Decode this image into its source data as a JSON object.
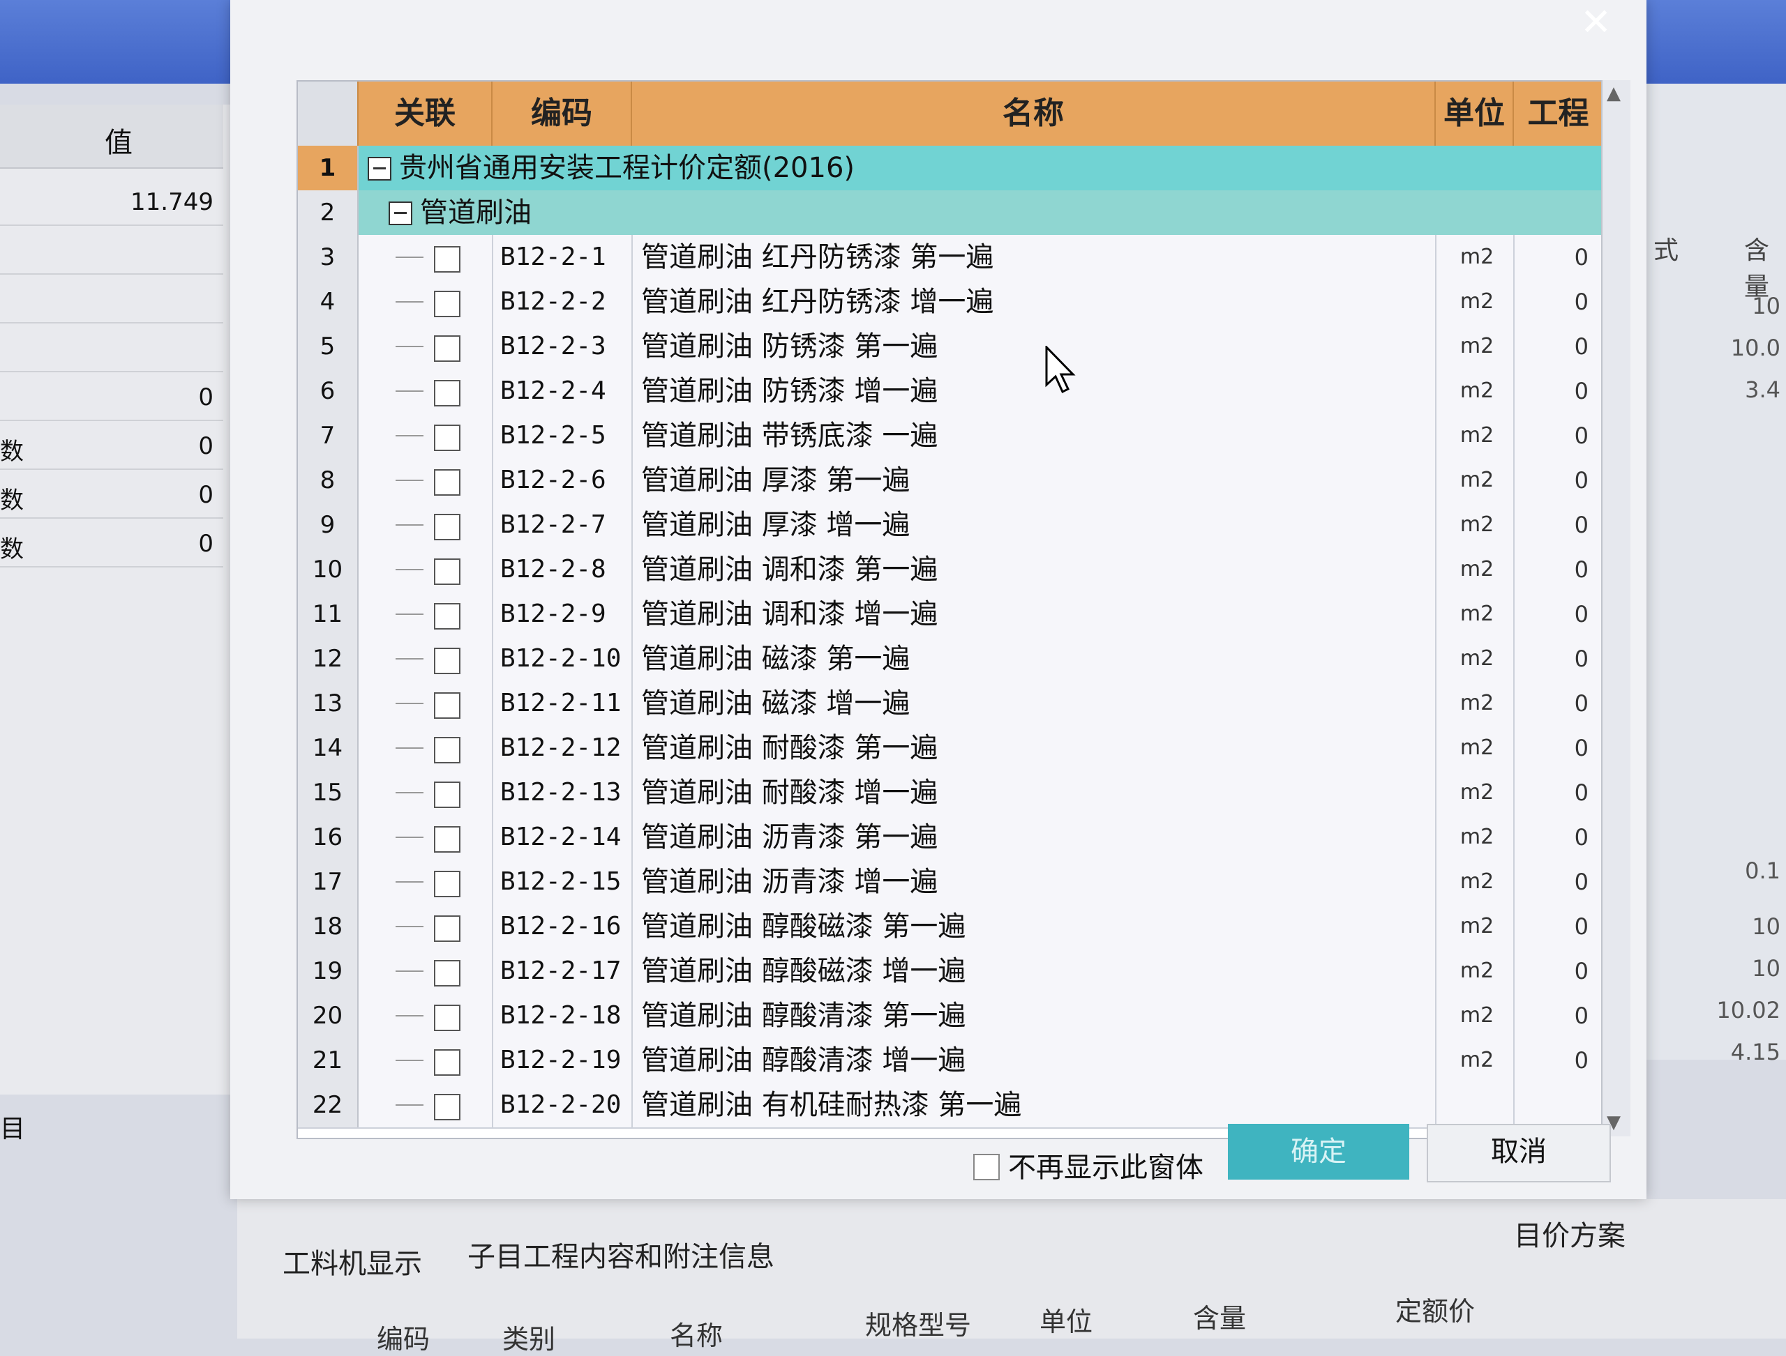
{
  "left_panel": {
    "header": "值",
    "rows": [
      {
        "label": "",
        "value": "11.749"
      },
      {
        "label": "",
        "value": ""
      },
      {
        "label": "",
        "value": ""
      },
      {
        "label": "",
        "value": ""
      },
      {
        "label": "",
        "value": "0"
      },
      {
        "label": "数",
        "value": "0"
      },
      {
        "label": "数",
        "value": "0"
      },
      {
        "label": "数",
        "value": "0"
      }
    ],
    "footer_label": "目"
  },
  "right_panel": {
    "header_left": "式",
    "header_right": "含量",
    "values": [
      "10",
      "10.0",
      "3.4",
      "0.1",
      "10",
      "10",
      "10.02",
      "4.15"
    ]
  },
  "dialog": {
    "close_label": "✕",
    "columns": {
      "relation": "关联",
      "code": "编码",
      "name": "名称",
      "unit": "单位",
      "quantity": "工程量"
    },
    "group1": {
      "num": "1",
      "title": "贵州省通用安装工程计价定额(2016)"
    },
    "group2": {
      "num": "2",
      "title": "管道刷油"
    },
    "items": [
      {
        "num": "3",
        "code": "B12-2-1",
        "name": "管道刷油 红丹防锈漆 第一遍",
        "unit": "m2",
        "qty": "0"
      },
      {
        "num": "4",
        "code": "B12-2-2",
        "name": "管道刷油 红丹防锈漆 增一遍",
        "unit": "m2",
        "qty": "0"
      },
      {
        "num": "5",
        "code": "B12-2-3",
        "name": "管道刷油 防锈漆 第一遍",
        "unit": "m2",
        "qty": "0"
      },
      {
        "num": "6",
        "code": "B12-2-4",
        "name": "管道刷油 防锈漆 增一遍",
        "unit": "m2",
        "qty": "0"
      },
      {
        "num": "7",
        "code": "B12-2-5",
        "name": "管道刷油 带锈底漆 一遍",
        "unit": "m2",
        "qty": "0"
      },
      {
        "num": "8",
        "code": "B12-2-6",
        "name": "管道刷油 厚漆 第一遍",
        "unit": "m2",
        "qty": "0"
      },
      {
        "num": "9",
        "code": "B12-2-7",
        "name": "管道刷油 厚漆 增一遍",
        "unit": "m2",
        "qty": "0"
      },
      {
        "num": "10",
        "code": "B12-2-8",
        "name": "管道刷油 调和漆 第一遍",
        "unit": "m2",
        "qty": "0"
      },
      {
        "num": "11",
        "code": "B12-2-9",
        "name": "管道刷油 调和漆 增一遍",
        "unit": "m2",
        "qty": "0"
      },
      {
        "num": "12",
        "code": "B12-2-10",
        "name": "管道刷油 磁漆 第一遍",
        "unit": "m2",
        "qty": "0"
      },
      {
        "num": "13",
        "code": "B12-2-11",
        "name": "管道刷油 磁漆 增一遍",
        "unit": "m2",
        "qty": "0"
      },
      {
        "num": "14",
        "code": "B12-2-12",
        "name": "管道刷油 耐酸漆 第一遍",
        "unit": "m2",
        "qty": "0"
      },
      {
        "num": "15",
        "code": "B12-2-13",
        "name": "管道刷油 耐酸漆 增一遍",
        "unit": "m2",
        "qty": "0"
      },
      {
        "num": "16",
        "code": "B12-2-14",
        "name": "管道刷油 沥青漆 第一遍",
        "unit": "m2",
        "qty": "0"
      },
      {
        "num": "17",
        "code": "B12-2-15",
        "name": "管道刷油 沥青漆 增一遍",
        "unit": "m2",
        "qty": "0"
      },
      {
        "num": "18",
        "code": "B12-2-16",
        "name": "管道刷油 醇酸磁漆 第一遍",
        "unit": "m2",
        "qty": "0"
      },
      {
        "num": "19",
        "code": "B12-2-17",
        "name": "管道刷油 醇酸磁漆 增一遍",
        "unit": "m2",
        "qty": "0"
      },
      {
        "num": "20",
        "code": "B12-2-18",
        "name": "管道刷油 醇酸清漆 第一遍",
        "unit": "m2",
        "qty": "0"
      },
      {
        "num": "21",
        "code": "B12-2-19",
        "name": "管道刷油 醇酸清漆 增一遍",
        "unit": "m2",
        "qty": "0"
      },
      {
        "num": "22",
        "code": "B12-2-20",
        "name": "管道刷油 有机硅耐热漆 第一遍",
        "unit": "",
        "qty": ""
      }
    ],
    "footer": {
      "dont_show_label": "不再显示此窗体",
      "ok_label": "确定",
      "cancel_label": "取消"
    }
  },
  "bottom_panel": {
    "tabs": [
      "工料机显示",
      "子目工程内容和附注信息"
    ],
    "right_label": "目价方案",
    "columns": [
      "编码",
      "类别",
      "名称",
      "规格型号",
      "单位",
      "含量",
      "定额价"
    ]
  },
  "colors": {
    "header_orange": "#e7a55f",
    "group_teal": "#71d3d3",
    "ok_teal": "#3fb4c0"
  }
}
